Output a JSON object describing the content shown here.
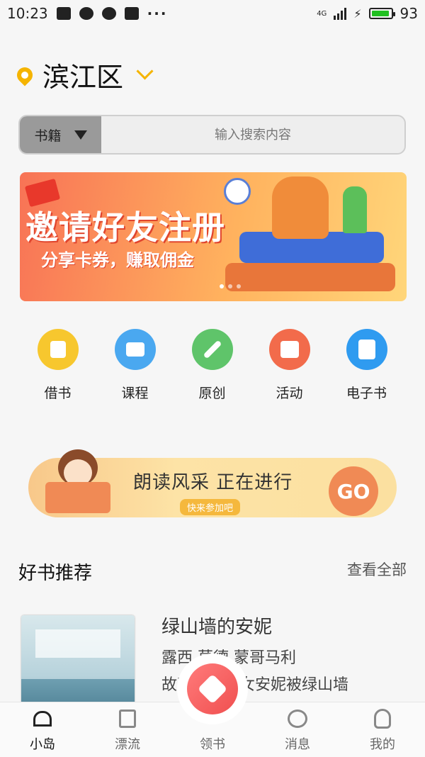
{
  "status": {
    "time": "10:23",
    "network": "4G",
    "battery": "93"
  },
  "location": {
    "city": "滨江区"
  },
  "search": {
    "category": "书籍",
    "placeholder": "输入搜索内容"
  },
  "banner": {
    "title": "邀请好友注册",
    "subtitle": "分享卡券，赚取佣金",
    "slide_count": 3,
    "active_slide": 0
  },
  "menu": [
    {
      "label": "借书",
      "color": "#f7c72e",
      "icon": "bookmark-icon"
    },
    {
      "label": "课程",
      "color": "#4aa8f0",
      "icon": "video-icon"
    },
    {
      "label": "原创",
      "color": "#5fc46a",
      "icon": "compass-icon"
    },
    {
      "label": "活动",
      "color": "#f26b4b",
      "icon": "calendar-icon"
    },
    {
      "label": "电子书",
      "color": "#2f9bf0",
      "icon": "ebook-icon"
    }
  ],
  "promo": {
    "title": "朗读风采  正在进行",
    "subtitle": "快来参加吧",
    "go": "GO"
  },
  "section": {
    "title": "好书推荐",
    "more": "查看全部"
  },
  "book": {
    "title": "绿山墙的安妮",
    "author": "露西.莫德.蒙哥马利",
    "desc": "故事讲述孤女安妮被绿山墙"
  },
  "tabs": [
    {
      "label": "小岛",
      "icon": "home-icon"
    },
    {
      "label": "漂流",
      "icon": "book-icon"
    },
    {
      "label": "领书",
      "icon": "heart-icon"
    },
    {
      "label": "消息",
      "icon": "message-icon"
    },
    {
      "label": "我的",
      "icon": "user-icon"
    }
  ]
}
